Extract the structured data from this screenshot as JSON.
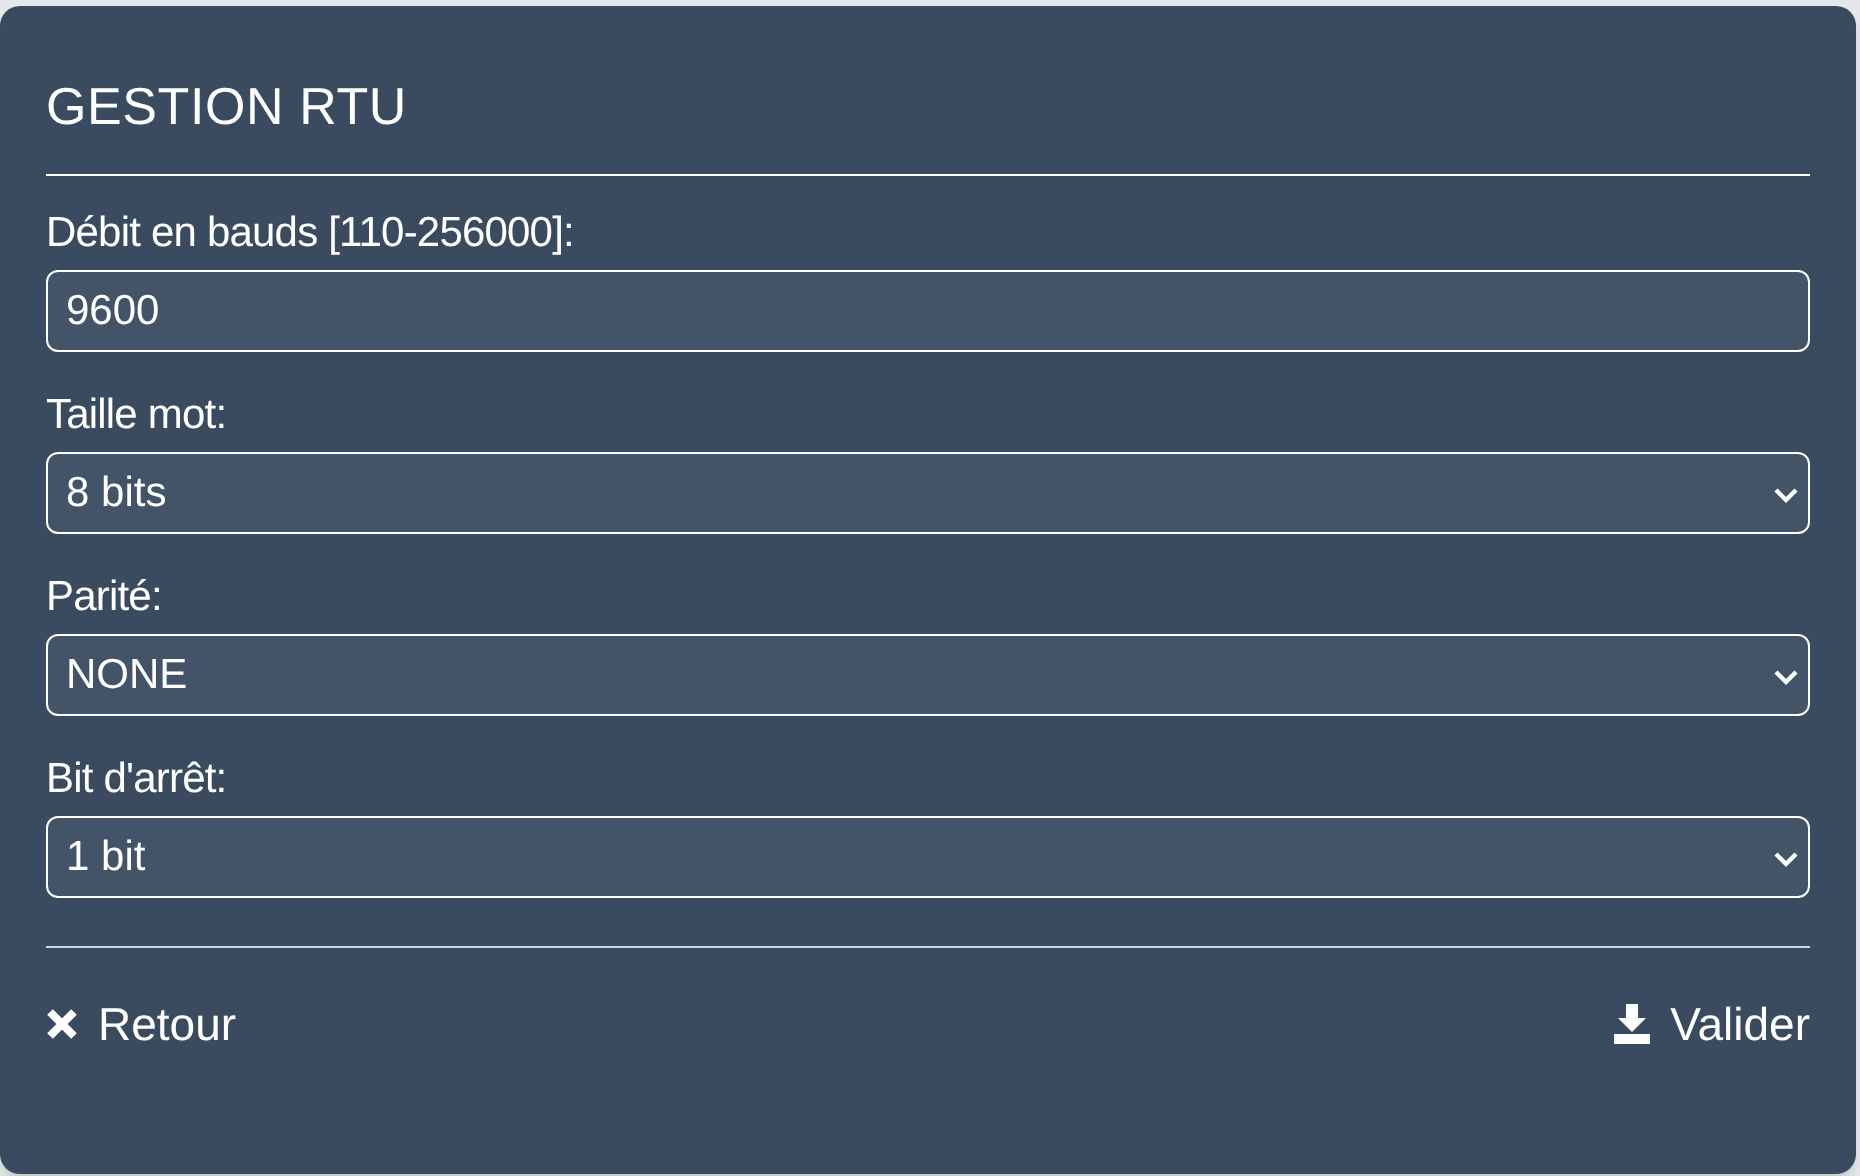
{
  "title": "GESTION RTU",
  "fields": [
    {
      "kind": "text",
      "label": "Débit en bauds [110-256000]:",
      "value": "9600"
    },
    {
      "kind": "select",
      "label": "Taille mot:",
      "value": "8 bits"
    },
    {
      "kind": "select",
      "label": "Parité:",
      "value": "NONE"
    },
    {
      "kind": "select",
      "label": "Bit d'arrêt:",
      "value": "1 bit"
    }
  ],
  "buttons": [
    {
      "kind": "cancel",
      "label": "Retour"
    },
    {
      "kind": "save",
      "label": "Valider"
    }
  ]
}
